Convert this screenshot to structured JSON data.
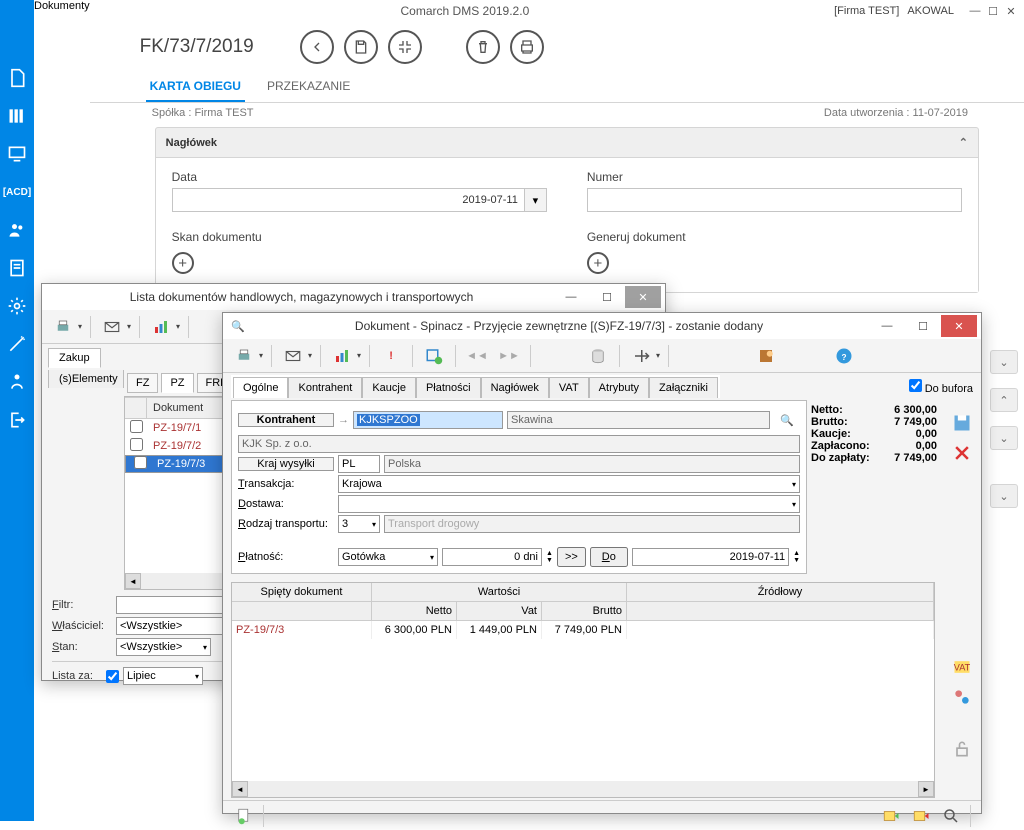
{
  "titlebar": {
    "title": "Comarch DMS 2019.2.0",
    "company": "[Firma TEST]",
    "user": "AKOWAL"
  },
  "doc": {
    "number": "FK/73/7/2019"
  },
  "side_tab": "Dokumenty",
  "tabs": {
    "karta": "KARTA OBIEGU",
    "przekazanie": "PRZEKAZANIE"
  },
  "meta": {
    "left": "Spółka : Firma TEST",
    "right": "Data utworzenia : 11-07-2019"
  },
  "form": {
    "naglowek": "Nagłówek",
    "data_label": "Data",
    "data_value": "2019-07-11",
    "numer_label": "Numer",
    "skan_label": "Skan dokumentu",
    "generuj_label": "Generuj dokument"
  },
  "lista_win": {
    "title": "Lista dokumentów handlowych, magazynowych i transportowych",
    "tab_zakup": "Zakup",
    "tab_elem": "(s)Elementy",
    "types": [
      "FZ",
      "PZ",
      "FRR"
    ],
    "col_dok": "Dokument",
    "rows": [
      "PZ-19/7/1",
      "PZ-19/7/2",
      "PZ-19/7/3"
    ],
    "filtr_label": "Filtr:",
    "wlasc_label": "Właściciel:",
    "stan_label": "Stan:",
    "wsz": "<Wszystkie>",
    "lista_za": "Lista za:",
    "lipiec": "Lipiec"
  },
  "dok_win": {
    "title": "Dokument - Spinacz - Przyjęcie zewnętrzne [(S)FZ-19/7/3]  - zostanie dodany",
    "do_bufora": "Do bufora",
    "tabs": [
      "Ogólne",
      "Kontrahent",
      "Kaucje",
      "Płatności",
      "Nagłówek",
      "VAT",
      "Atrybuty",
      "Załączniki"
    ],
    "kontrahent_label": "Kontrahent",
    "kontrahent_code": "KJKSPZOO",
    "kontrahent_city": "Skawina",
    "kontrahent_name": "KJK Sp. z o.o.",
    "kraj_label": "Kraj wysyłki",
    "kraj_code": "PL",
    "kraj_name": "Polska",
    "trans_label": "Transakcja:",
    "trans_val": "Krajowa",
    "dostawa_label": "Dostawa:",
    "rodzaj_label": "Rodzaj transportu:",
    "rodzaj_code": "3",
    "rodzaj_name": "Transport drogowy",
    "platnosc_label": "Płatność:",
    "platnosc_val": "Gotówka",
    "platnosc_dni": "0 dni",
    "przycisk_next": ">>",
    "przycisk_do": "Do",
    "platnosc_date": "2019-07-11",
    "tot": {
      "netto_l": "Netto:",
      "netto_v": "6 300,00",
      "brutto_l": "Brutto:",
      "brutto_v": "7 749,00",
      "kaucje_l": "Kaucje:",
      "kaucje_v": "0,00",
      "zaplacono_l": "Zapłacono:",
      "zaplacono_v": "0,00",
      "do_l": "Do zapłaty:",
      "do_v": "7 749,00"
    },
    "grid": {
      "col_spiety": "Spięty dokument",
      "col_wart": "Wartości",
      "col_netto": "Netto",
      "col_vat": "Vat",
      "col_brutto": "Brutto",
      "col_zrodlowy": "Źródłowy",
      "row": {
        "doc": "PZ-19/7/3",
        "netto": "6 300,00 PLN",
        "vat": "1 449,00 PLN",
        "brutto": "7 749,00 PLN"
      }
    }
  }
}
